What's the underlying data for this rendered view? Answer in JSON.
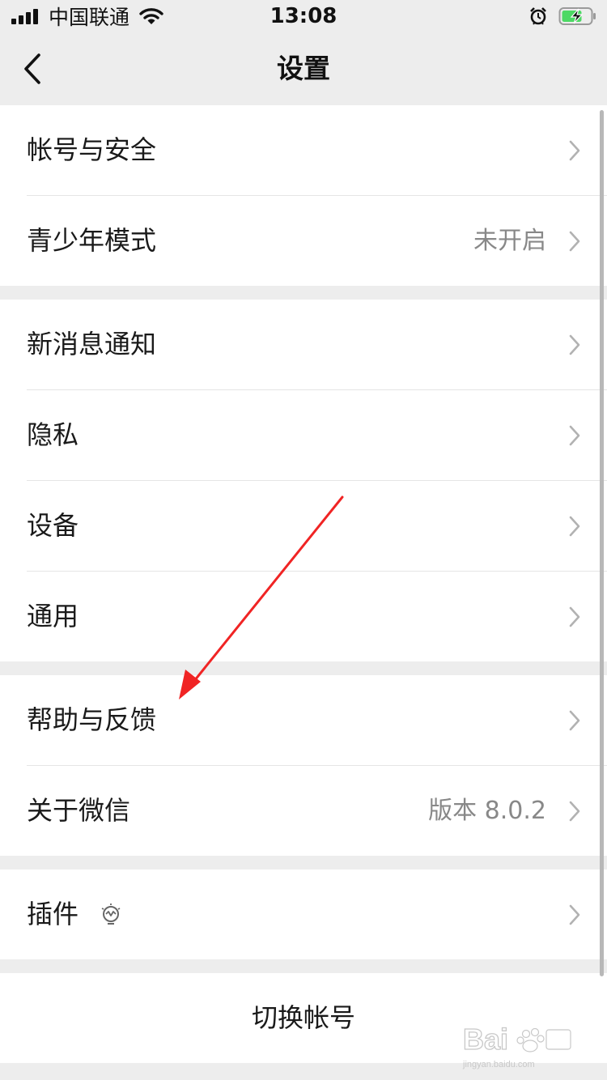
{
  "status_bar": {
    "carrier": "中国联通",
    "time": "13:08"
  },
  "nav": {
    "title": "设置"
  },
  "groups": [
    {
      "items": [
        {
          "label": "帐号与安全",
          "value": ""
        },
        {
          "label": "青少年模式",
          "value": "未开启"
        }
      ]
    },
    {
      "items": [
        {
          "label": "新消息通知",
          "value": ""
        },
        {
          "label": "隐私",
          "value": ""
        },
        {
          "label": "设备",
          "value": ""
        },
        {
          "label": "通用",
          "value": ""
        }
      ]
    },
    {
      "items": [
        {
          "label": "帮助与反馈",
          "value": ""
        },
        {
          "label": "关于微信",
          "value": "版本 8.0.2"
        }
      ]
    },
    {
      "items": [
        {
          "label": "插件",
          "value": "",
          "icon": "plugin-bulb-icon"
        }
      ]
    }
  ],
  "switch_account": {
    "label": "切换帐号"
  },
  "watermark": {
    "brand": "Bai",
    "site": "jingyan.baidu.com"
  },
  "colors": {
    "background": "#ededed",
    "cell": "#ffffff",
    "secondary_text": "#888888",
    "annotation_arrow": "#f02424",
    "battery_charge": "#4cd964"
  }
}
